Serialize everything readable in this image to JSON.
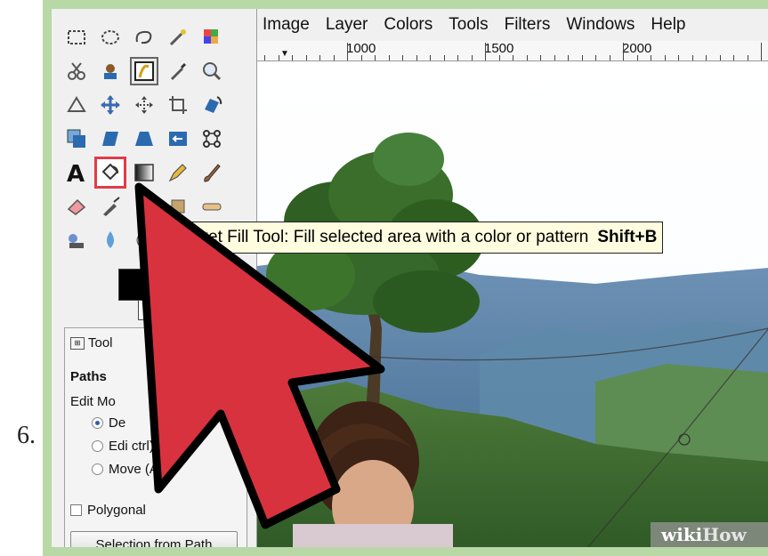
{
  "step": {
    "number": "6."
  },
  "menubar": {
    "items": [
      "Image",
      "Layer",
      "Colors",
      "Tools",
      "Filters",
      "Windows",
      "Help"
    ]
  },
  "ruler": {
    "labels": [
      "1000",
      "1500",
      "2000"
    ]
  },
  "toolbox": {
    "tools": [
      "rect-select-icon",
      "ellipse-select-icon",
      "free-select-icon",
      "fuzzy-select-icon",
      "color-select-icon",
      "scissors-select-icon",
      "foreground-select-icon",
      "paths-icon",
      "color-picker-icon",
      "zoom-icon",
      "measure-icon",
      "move-icon",
      "align-icon",
      "crop-icon",
      "rotate-icon",
      "scale-icon",
      "shear-icon",
      "perspective-icon",
      "flip-icon",
      "cage-icon",
      "text-icon",
      "bucket-fill-icon",
      "blend-icon",
      "pencil-icon",
      "paintbrush-icon",
      "eraser-icon",
      "airbrush-icon",
      "ink-icon",
      "clone-icon",
      "heal-icon",
      "smudge-icon",
      "blur-icon",
      "dodge-icon",
      "",
      ""
    ],
    "active_tool": "bucket-fill-icon",
    "foreground_color": "#000000",
    "background_color": "#ffffff"
  },
  "tool_options": {
    "tab_label": "Tool",
    "title": "Paths",
    "edit_mode_label": "Edit Mo",
    "radio_options": [
      {
        "label": "De",
        "selected": true
      },
      {
        "label": "Edi  ctrl)",
        "selected": false
      },
      {
        "label": "Move (Alt)",
        "selected": false
      }
    ],
    "polygonal_label": "Polygonal",
    "selection_button_label": "Selection from Path"
  },
  "tooltip": {
    "text": "cket Fill Tool: Fill selected area with a color or pattern",
    "shortcut": "Shift+B"
  },
  "watermark": {
    "wiki": "wiki",
    "how": "How"
  },
  "colors": {
    "frame_green": "#b8d8a6",
    "highlight_red": "#e23b4a",
    "arrow_red": "#d8323f",
    "tooltip_bg": "#fffde0"
  }
}
